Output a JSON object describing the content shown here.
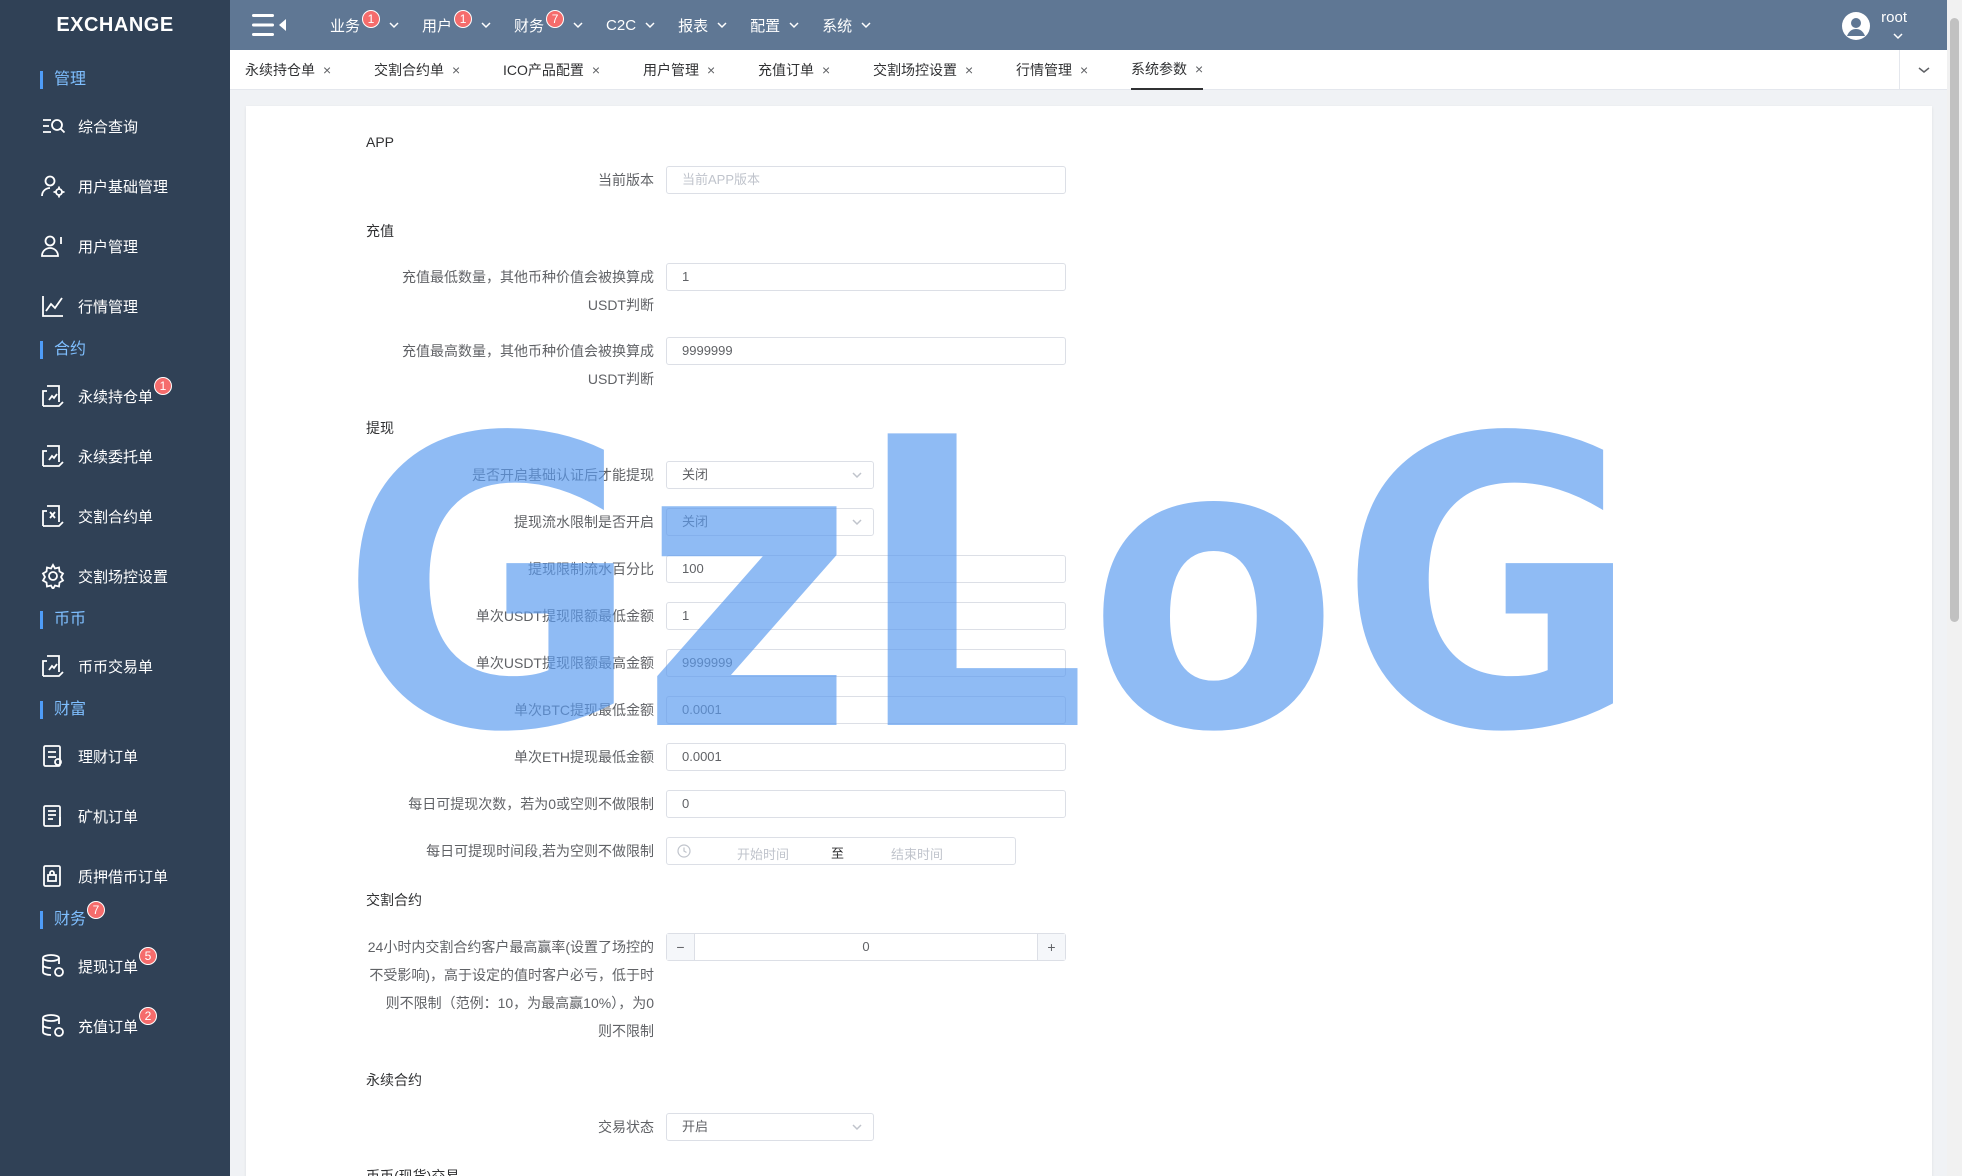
{
  "app": {
    "title": "EXCHANGE"
  },
  "sidebar": {
    "groups": [
      {
        "label": "管理",
        "badge": ""
      },
      {
        "label": "合约",
        "badge": ""
      },
      {
        "label": "币币",
        "badge": ""
      },
      {
        "label": "财富",
        "badge": ""
      },
      {
        "label": "财务",
        "badge": "7"
      }
    ],
    "items": [
      {
        "label": "综合查询",
        "icon": "search-list-icon",
        "badge": ""
      },
      {
        "label": "用户基础管理",
        "icon": "user-gear-icon",
        "badge": ""
      },
      {
        "label": "用户管理",
        "icon": "user-icon",
        "badge": ""
      },
      {
        "label": "行情管理",
        "icon": "line-chart-icon",
        "badge": ""
      },
      {
        "label": "永续持仓单",
        "icon": "document-chart-icon",
        "badge": "1"
      },
      {
        "label": "永续委托单",
        "icon": "document-chart-icon",
        "badge": ""
      },
      {
        "label": "交割合约单",
        "icon": "document-chart-icon",
        "badge": ""
      },
      {
        "label": "交割场控设置",
        "icon": "gear-icon",
        "badge": ""
      },
      {
        "label": "币币交易单",
        "icon": "document-chart-icon",
        "badge": ""
      },
      {
        "label": "理财订单",
        "icon": "document-icon",
        "badge": ""
      },
      {
        "label": "矿机订单",
        "icon": "document-list-icon",
        "badge": ""
      },
      {
        "label": "质押借币订单",
        "icon": "document-lock-icon",
        "badge": ""
      },
      {
        "label": "提现订单",
        "icon": "database-icon",
        "badge": "5"
      },
      {
        "label": "充值订单",
        "icon": "database-icon",
        "badge": "2"
      }
    ]
  },
  "topnav": {
    "items": [
      {
        "label": "业务",
        "badge": "1"
      },
      {
        "label": "用户",
        "badge": "1"
      },
      {
        "label": "财务",
        "badge": "7"
      },
      {
        "label": "C2C",
        "badge": ""
      },
      {
        "label": "报表",
        "badge": ""
      },
      {
        "label": "配置",
        "badge": ""
      },
      {
        "label": "系统",
        "badge": ""
      }
    ],
    "user": "root"
  },
  "tabs": [
    {
      "label": "永续持仓单",
      "active": false
    },
    {
      "label": "交割合约单",
      "active": false
    },
    {
      "label": "ICO产品配置",
      "active": false
    },
    {
      "label": "用户管理",
      "active": false
    },
    {
      "label": "充值订单",
      "active": false
    },
    {
      "label": "交割场控设置",
      "active": false
    },
    {
      "label": "行情管理",
      "active": false
    },
    {
      "label": "系统参数",
      "active": true
    }
  ],
  "form": {
    "sections": {
      "app": "APP",
      "recharge": "充值",
      "withdraw": "提现",
      "delivery": "交割合约",
      "perpetual": "永续合约",
      "spot": "币币(现货)交易"
    },
    "app_version": {
      "label": "当前版本",
      "placeholder": "当前APP版本",
      "value": ""
    },
    "recharge_min": {
      "label_line1": "充值最低数量，其他币种价值会被换算成",
      "label_line2": "USDT判断",
      "value": "1"
    },
    "recharge_max": {
      "label_line1": "充值最高数量，其他币种价值会被换算成",
      "label_line2": "USDT判断",
      "value": "9999999"
    },
    "withdraw_auth": {
      "label": "是否开启基础认证后才能提现",
      "value": "关闭"
    },
    "withdraw_flow": {
      "label": "提现流水限制是否开启",
      "value": "关闭"
    },
    "withdraw_flow_pct": {
      "label": "提现限制流水百分比",
      "value": "100"
    },
    "usdt_min": {
      "label": "单次USDT提现限额最低金额",
      "value": "1"
    },
    "usdt_max": {
      "label": "单次USDT提现限额最高金额",
      "value": "9999999"
    },
    "btc_min": {
      "label": "单次BTC提现最低金额",
      "value": "0.0001"
    },
    "eth_min": {
      "label": "单次ETH提现最低金额",
      "value": "0.0001"
    },
    "daily_count": {
      "label": "每日可提现次数，若为0或空则不做限制",
      "value": "0"
    },
    "daily_time": {
      "label": "每日可提现时间段,若为空则不做限制",
      "start_placeholder": "开始时间",
      "separator": "至",
      "end_placeholder": "结束时间"
    },
    "delivery_rate": {
      "label_lines": [
        "24小时内交割合约客户最高赢率(设置了场控的",
        "不受影响)，高于设定的值时客户必亏，低于时",
        "则不限制（范例：10，为最高赢10%），为0",
        "则不限制"
      ],
      "minus": "−",
      "plus": "+",
      "value": "0"
    },
    "trade_status": {
      "label": "交易状态",
      "value": "开启"
    }
  },
  "watermark": {
    "text": "GzLoG",
    "color": "#5b9bef"
  }
}
